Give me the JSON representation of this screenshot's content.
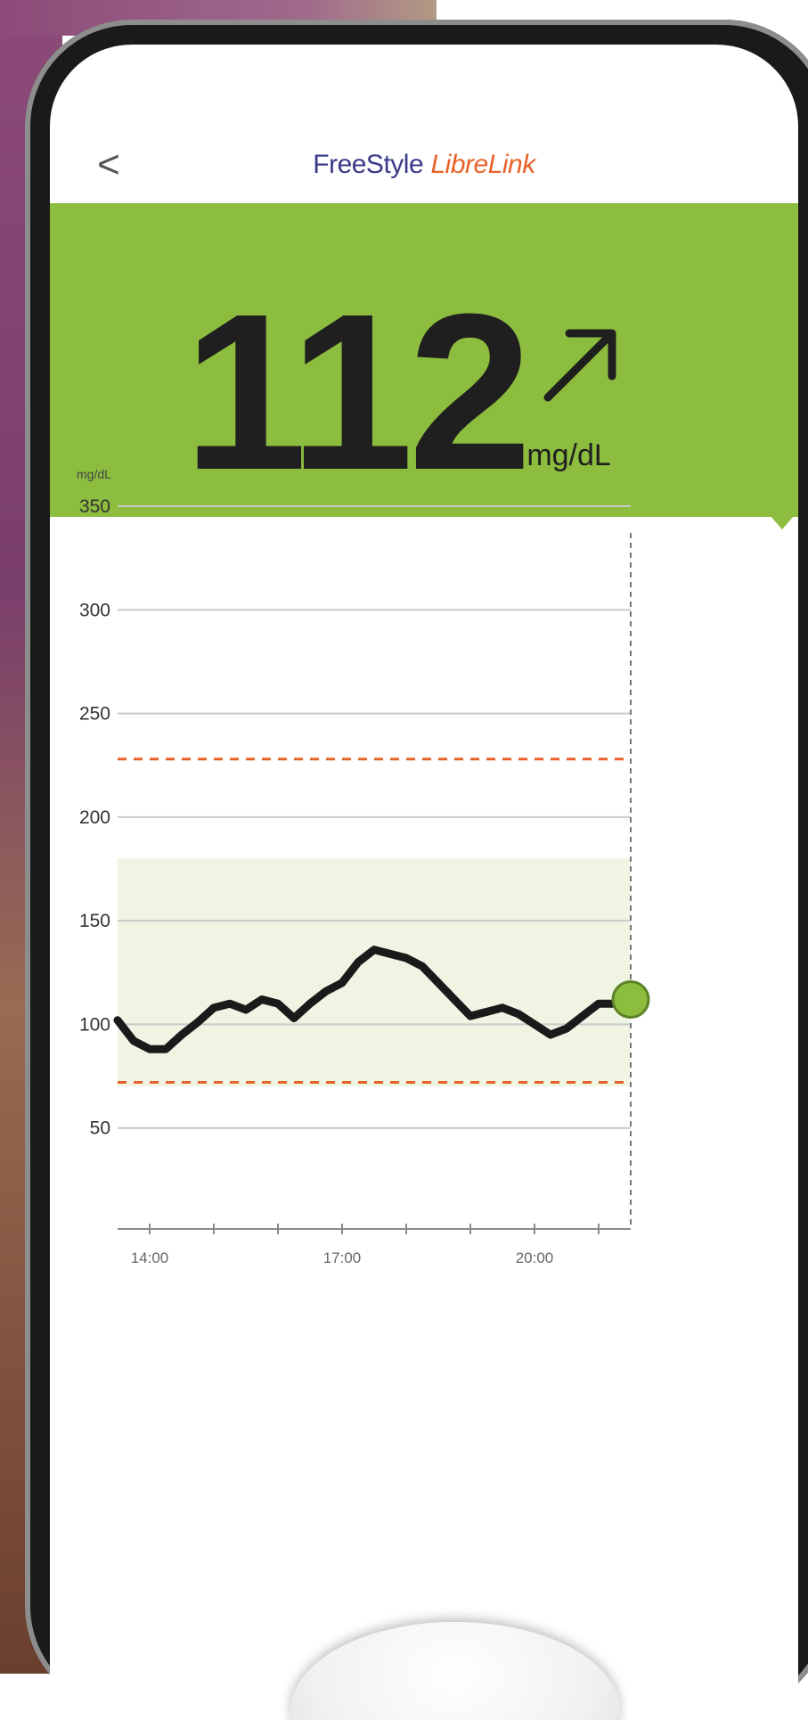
{
  "header": {
    "back_glyph": "<",
    "brand_part1": "FreeStyle",
    "brand_part2": "LibreLink"
  },
  "reading": {
    "value": "112",
    "unit": "mg/dL",
    "trend_icon": "arrow-up-right-icon"
  },
  "colors": {
    "brand_blue": "#3a3a8a",
    "brand_orange": "#e8622a",
    "in_range_green": "#8cbd3f",
    "target_band": "#eff4e3",
    "limit_line": "#e8622a",
    "trace": "#1a1a1a"
  },
  "chart_data": {
    "type": "line",
    "unit_label": "mg/dL",
    "ylim": [
      0,
      350
    ],
    "yticks": [
      350,
      300,
      250,
      200,
      150,
      100,
      50
    ],
    "x_ticks": [
      "14:00",
      "17:00",
      "20:00"
    ],
    "xlim": [
      "13:30",
      "21:30"
    ],
    "grid": true,
    "target_range": [
      70,
      180
    ],
    "limit_lines": [
      72,
      228
    ],
    "series": [
      {
        "x": [
          "13:30",
          "13:45",
          "14:00",
          "14:15",
          "14:30",
          "14:45",
          "15:00",
          "15:15",
          "15:30",
          "15:45",
          "16:00",
          "16:15",
          "16:30",
          "16:45",
          "17:00",
          "17:15",
          "17:30",
          "17:45",
          "18:00",
          "18:15",
          "18:30",
          "18:45",
          "19:00",
          "19:15",
          "19:30",
          "19:45",
          "20:00",
          "20:15",
          "20:30",
          "20:45",
          "21:00",
          "21:15",
          "21:30"
        ],
        "y": [
          102,
          92,
          88,
          88,
          95,
          101,
          108,
          110,
          107,
          112,
          110,
          103,
          110,
          116,
          120,
          130,
          136,
          134,
          132,
          128,
          120,
          112,
          104,
          106,
          108,
          105,
          100,
          95,
          98,
          104,
          110,
          110,
          112
        ]
      }
    ],
    "current": {
      "x": "21:30",
      "y": 112
    }
  }
}
